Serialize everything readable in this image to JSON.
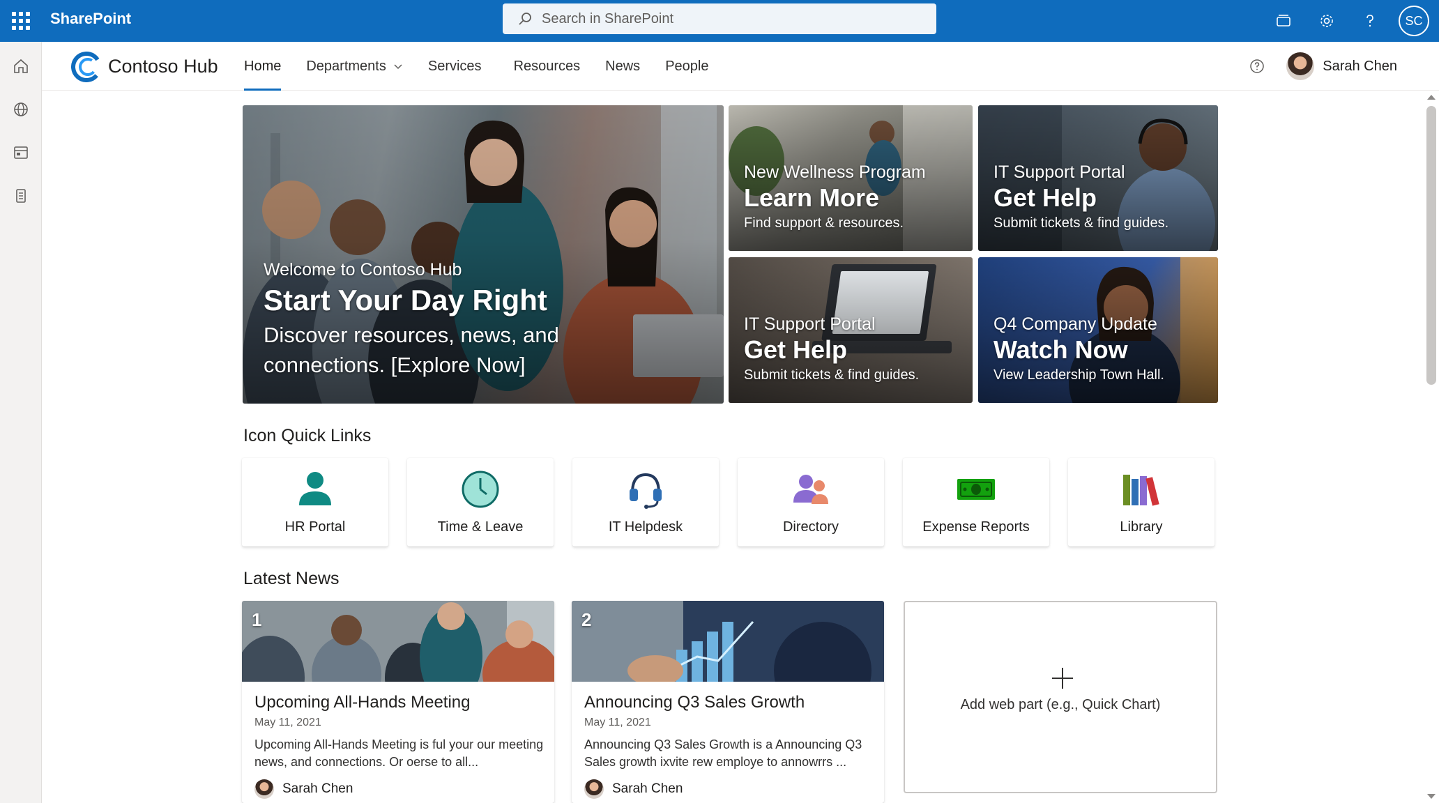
{
  "suite": {
    "brand": "SharePoint",
    "search_placeholder": "Search in SharePoint",
    "user_initials": "SC"
  },
  "hub": {
    "title": "Contoso Hub",
    "nav": [
      {
        "label": "Home",
        "active": true
      },
      {
        "label": "Departments",
        "has_dropdown": true
      },
      {
        "label": "Services"
      },
      {
        "label": "Resources"
      },
      {
        "label": "News"
      },
      {
        "label": "People"
      }
    ],
    "user_name": "Sarah Chen"
  },
  "hero": {
    "main": {
      "kicker": "Welcome to Contoso Hub",
      "title": "Start Your Day Right",
      "description": "Discover resources, news, and connections. [Explore Now]"
    },
    "tiles": [
      {
        "kicker": "New Wellness Program",
        "title": "Learn More",
        "subtitle": "Find support & resources."
      },
      {
        "kicker": "IT Support Portal",
        "title": "Get Help",
        "subtitle": "Submit tickets & find guides."
      },
      {
        "kicker": "IT Support Portal",
        "title": "Get Help",
        "subtitle": "Submit tickets & find guides."
      },
      {
        "kicker": "Q4 Company Update",
        "title": "Watch Now",
        "subtitle": "View Leadership Town Hall."
      }
    ]
  },
  "quick_links": {
    "heading": "Icon Quick Links",
    "items": [
      {
        "label": "HR Portal",
        "icon": "person-icon"
      },
      {
        "label": "Time & Leave",
        "icon": "clock-icon"
      },
      {
        "label": "IT Helpdesk",
        "icon": "headset-icon"
      },
      {
        "label": "Directory",
        "icon": "people-icon"
      },
      {
        "label": "Expense Reports",
        "icon": "money-icon"
      },
      {
        "label": "Library",
        "icon": "books-icon"
      }
    ]
  },
  "news": {
    "heading": "Latest News",
    "items": [
      {
        "number": "1",
        "title": "Upcoming All-Hands Meeting",
        "date": "May 11, 2021",
        "description": "Upcoming All-Hands Meeting is ful your our meeting news, and connections. Or oerse to all...",
        "author": "Sarah Chen"
      },
      {
        "number": "2",
        "title": "Announcing Q3 Sales Growth",
        "date": "May 11, 2021",
        "description": "Announcing Q3 Sales Growth is a Announcing Q3 Sales growth ixvite rew employe to annowrrs ...",
        "author": "Sarah Chen"
      }
    ],
    "add_web_part": "Add web part (e.g., Quick Chart)"
  },
  "colors": {
    "suite_bar": "#0f6cbd",
    "accent": "#0f6cbd",
    "teal": "#0f8a83"
  }
}
